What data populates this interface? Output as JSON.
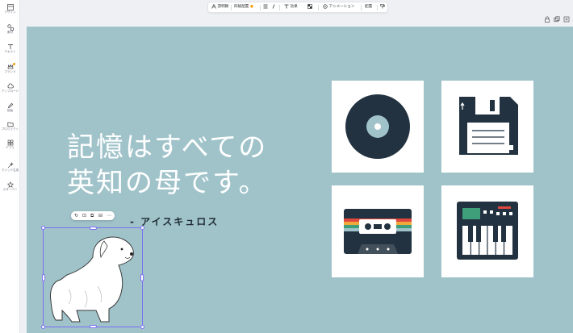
{
  "rail": {
    "items": [
      {
        "label": "デザイン"
      },
      {
        "label": "素材"
      },
      {
        "label": "テキスト"
      },
      {
        "label": "ブランド"
      },
      {
        "label": "アップロード"
      },
      {
        "label": "描画"
      },
      {
        "label": "プロジェクト"
      },
      {
        "label": "アプリ"
      },
      {
        "label": "マジック生成"
      },
      {
        "label": "スターバー"
      }
    ]
  },
  "toolbar": {
    "font_label": "游明朝",
    "size_label": "四級配置",
    "effect_label": "効果",
    "animate_label": "アニメーション",
    "position_label": "配置"
  },
  "slide": {
    "quote_line1": "記憶はすべての",
    "quote_line2": "英知の母です。",
    "author": "- アイスキュロス",
    "background": "#a0c3ca"
  },
  "cards": [
    {
      "icon": "vinyl-record-icon"
    },
    {
      "icon": "floppy-disk-icon"
    },
    {
      "icon": "cassette-tape-icon"
    },
    {
      "icon": "synthesizer-icon"
    }
  ],
  "selection": {
    "target": "dog-illustration"
  }
}
